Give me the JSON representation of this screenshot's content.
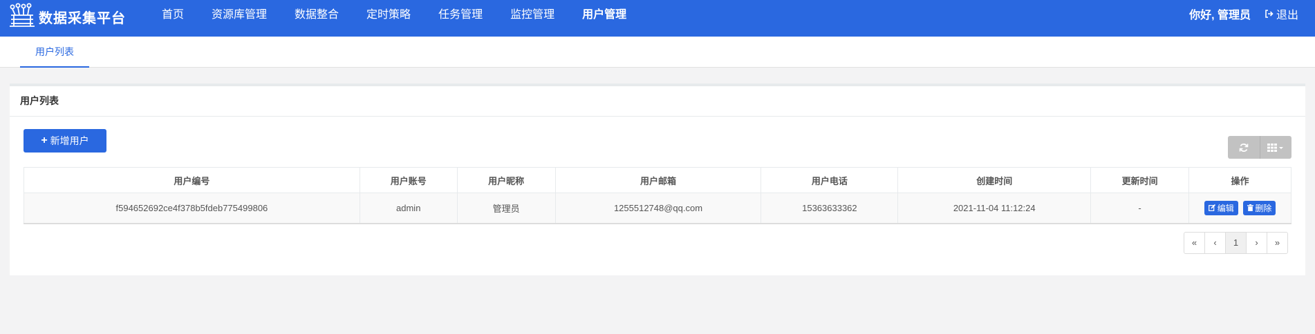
{
  "brand": {
    "title": "数据采集平台",
    "logo_icon": "data-hub-icon"
  },
  "nav": {
    "items": [
      {
        "label": "首页"
      },
      {
        "label": "资源库管理"
      },
      {
        "label": "数据整合"
      },
      {
        "label": "定时策略"
      },
      {
        "label": "任务管理"
      },
      {
        "label": "监控管理"
      },
      {
        "label": "用户管理",
        "active": true
      }
    ]
  },
  "user": {
    "greeting": "你好, 管理员",
    "logout_label": "退出",
    "logout_icon": "sign-out-icon"
  },
  "tabs": [
    {
      "label": "用户列表",
      "active": true
    }
  ],
  "panel": {
    "title": "用户列表",
    "add_button": {
      "icon": "plus-icon",
      "label": "新增用户"
    },
    "toolbar": {
      "refresh_icon": "refresh-icon",
      "columns_icon": "grid-columns-icon"
    }
  },
  "table": {
    "columns": [
      "用户编号",
      "用户账号",
      "用户昵称",
      "用户邮箱",
      "用户电话",
      "创建时间",
      "更新时间",
      "操作"
    ],
    "rows": [
      {
        "id": "f594652692ce4f378b5fdeb775499806",
        "account": "admin",
        "nickname": "管理员",
        "email": "1255512748@qq.com",
        "phone": "15363633362",
        "created": "2021-11-04 11:12:24",
        "updated": "-",
        "edit_label": "编辑",
        "delete_label": "删除"
      }
    ]
  },
  "pagination": {
    "first": "«",
    "prev": "‹",
    "current": "1",
    "next": "›",
    "last": "»"
  },
  "colors": {
    "primary": "#2a68e0",
    "toolbar_gray": "#c2c2c2",
    "page_bg": "#f3f3f4"
  }
}
